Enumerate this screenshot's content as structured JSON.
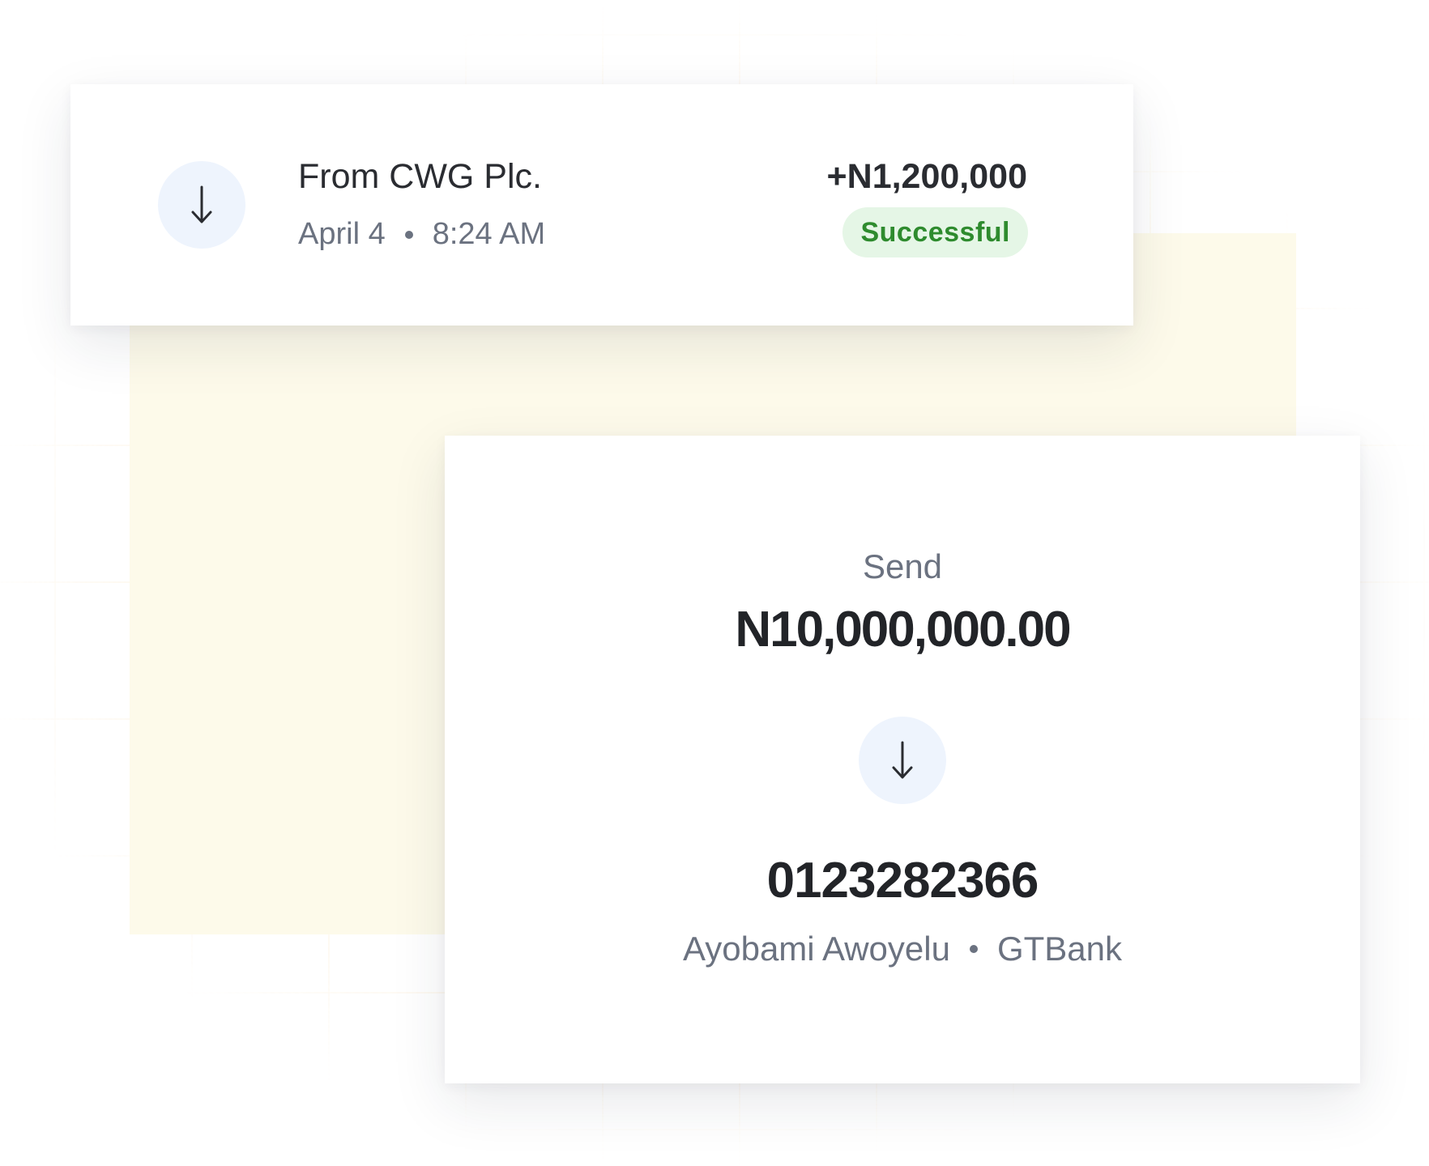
{
  "incoming_transaction": {
    "icon": "arrow-down-icon",
    "title": "From CWG Plc.",
    "date": "April 4",
    "time": "8:24 AM",
    "amount": "+N1,200,000",
    "status": "Successful"
  },
  "send": {
    "label": "Send",
    "amount": "N10,000,000.00",
    "icon": "arrow-down-icon",
    "account_number": "0123282366",
    "recipient_name": "Ayobami Awoyelu",
    "bank": "GTBank"
  },
  "colors": {
    "text_primary": "#2a2c31",
    "text_secondary": "#6b7280",
    "icon_circle_bg": "#eef4fd",
    "success_bg": "#e5f6e6",
    "success_text": "#2e8b2e",
    "cream_bg": "#fdfaea",
    "grid_line": "#f6d296"
  }
}
